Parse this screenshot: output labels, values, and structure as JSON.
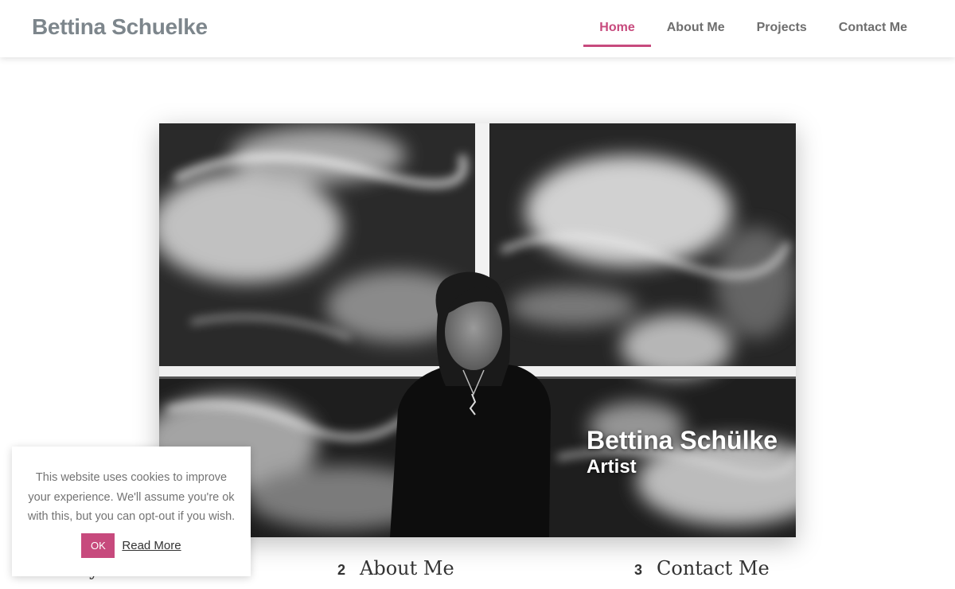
{
  "header": {
    "site_title": "Bettina Schuelke",
    "nav": [
      {
        "label": "Home",
        "active": true
      },
      {
        "label": "About Me",
        "active": false
      },
      {
        "label": "Projects",
        "active": false
      },
      {
        "label": "Contact Me",
        "active": false
      }
    ]
  },
  "hero": {
    "name": "Bettina Schülke",
    "role": "Artist"
  },
  "sections": [
    {
      "number": "",
      "title": "y"
    },
    {
      "number": "2",
      "title": "About Me"
    },
    {
      "number": "3",
      "title": "Contact Me"
    }
  ],
  "cookie_notice": {
    "text": "This website uses cookies to improve your experience. We'll assume you're ok with this, but you can opt-out if you wish.",
    "ok_label": "OK",
    "read_more_label": "Read More"
  },
  "colors": {
    "accent": "#c74a7d",
    "title_gray": "#7d868c",
    "nav_gray": "#6e6e6e"
  }
}
